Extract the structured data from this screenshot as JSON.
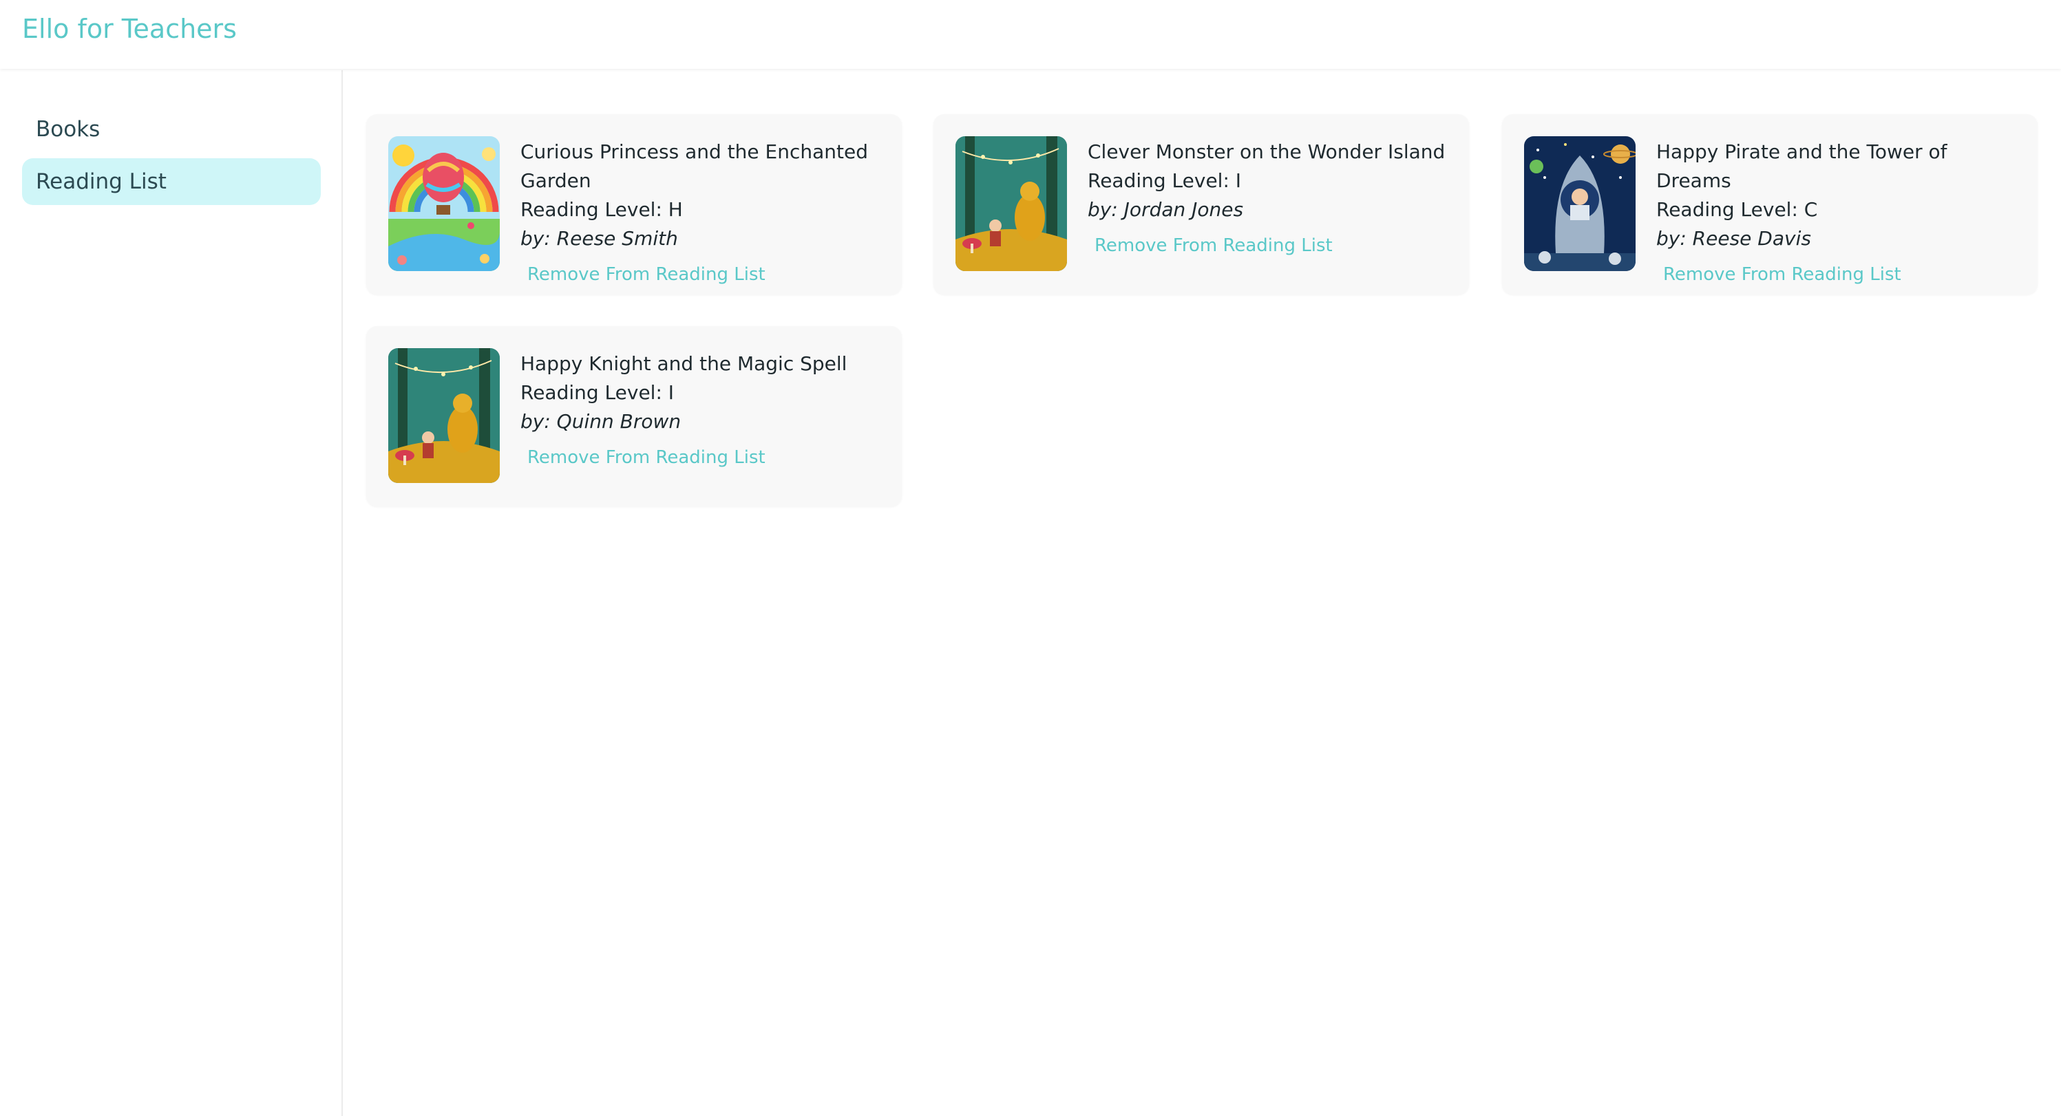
{
  "app": {
    "title": "Ello for Teachers"
  },
  "sidebar": {
    "items": [
      {
        "label": "Books",
        "active": false
      },
      {
        "label": "Reading List",
        "active": true
      }
    ]
  },
  "reading_list": {
    "remove_label": "Remove From Reading List",
    "books": [
      {
        "title": "Curious Princess and the Enchanted Garden",
        "level": "Reading Level: H",
        "author": "by: Reese Smith",
        "cover": "rainbow-balloon-meadow"
      },
      {
        "title": "Clever Monster on the Wonder Island",
        "level": "Reading Level: I",
        "author": "by: Jordan Jones",
        "cover": "enchanted-forest-dragon"
      },
      {
        "title": "Happy Pirate and the Tower of Dreams",
        "level": "Reading Level: C",
        "author": "by: Reese Davis",
        "cover": "space-rocket-astronaut"
      },
      {
        "title": "Happy Knight and the Magic Spell",
        "level": "Reading Level: I",
        "author": "by: Quinn Brown",
        "cover": "enchanted-forest-dragon"
      }
    ]
  },
  "colors": {
    "accent": "#5ac8c8",
    "active_nav_bg": "#cff6f8",
    "card_bg": "#f8f8f8",
    "text": "#1f2a2f",
    "nav_text": "#2c4a52"
  }
}
